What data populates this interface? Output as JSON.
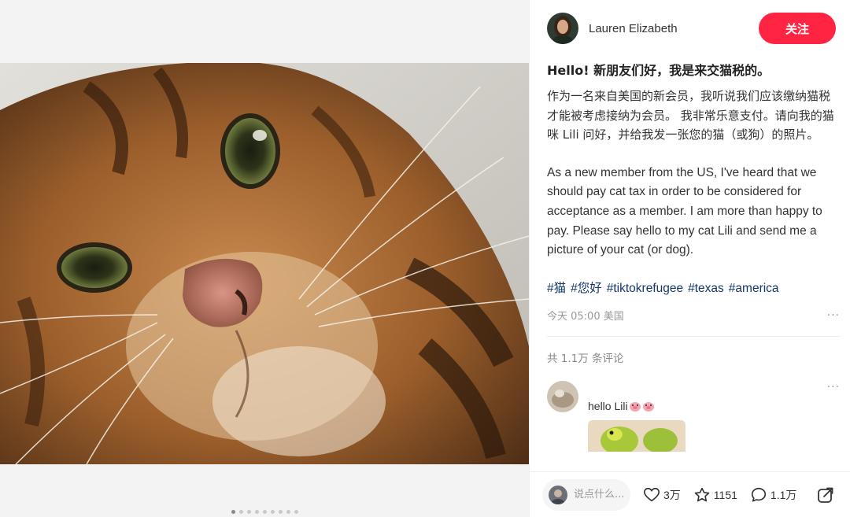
{
  "author": {
    "name": "Lauren Elizabeth",
    "follow_label": "关注"
  },
  "post": {
    "title": "Hello! 新朋友们好，我是来交猫税的。",
    "body_zh": "作为一名来自美国的新会员，我听说我们应该缴纳猫税才能被考虑接纳为会员。 我非常乐意支付。请向我的猫咪 Lili 问好，并给我发一张您的猫（或狗）的照片。",
    "body_en": "As a new member from the US, I've heard that we should pay cat tax in order to be considered for acceptance as a member. I am more than happy to pay. Please say hello to my cat Lili and send me a picture of your cat (or dog).",
    "tags": [
      "#猫",
      "#您好",
      "#tiktokrefugee",
      "#texas",
      "#america"
    ],
    "meta": "今天 05:00 美国",
    "more": "···"
  },
  "comments": {
    "count_label": "共 1.1万 条评论",
    "items": [
      {
        "text": "hello Lili",
        "more": "···"
      }
    ]
  },
  "gallery": {
    "total": 9,
    "active_index": 0
  },
  "bottom_bar": {
    "input_placeholder": "说点什么...",
    "likes": "3万",
    "favorites": "1151",
    "comments": "1.1万"
  },
  "colors": {
    "accent": "#ff2442",
    "tag": "#13386c"
  },
  "icons": [
    "heart-icon",
    "star-icon",
    "comment-icon",
    "share-icon",
    "pig-emoji-icon"
  ]
}
